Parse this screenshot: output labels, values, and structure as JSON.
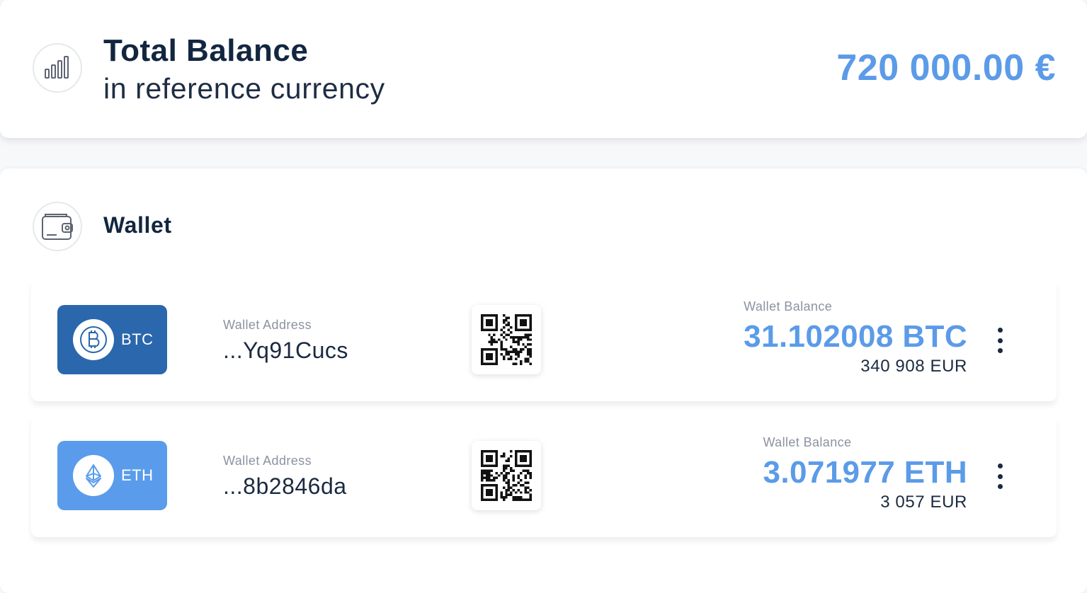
{
  "balance": {
    "title": "Total Balance",
    "subtitle": "in reference currency",
    "amount": "720 000.00 €",
    "icon": "bar-chart-icon"
  },
  "wallet": {
    "title": "Wallet",
    "icon": "wallet-icon",
    "rows": [
      {
        "ticker": "BTC",
        "coin_icon": "bitcoin-icon",
        "address_label": "Wallet Address",
        "address": "...Yq91Cucs",
        "balance_label": "Wallet Balance",
        "balance": "31.102008 BTC",
        "eur": "340 908 EUR",
        "badge_color": "#2a67ad"
      },
      {
        "ticker": "ETH",
        "coin_icon": "ethereum-icon",
        "address_label": "Wallet Address",
        "address": "...8b2846da",
        "balance_label": "Wallet Balance",
        "balance": "3.071977 ETH",
        "eur": "3 057 EUR",
        "badge_color": "#5a9ceb"
      }
    ]
  },
  "colors": {
    "accent": "#5b9be8",
    "dark_text": "#122640",
    "muted_text": "#8a93a0"
  }
}
